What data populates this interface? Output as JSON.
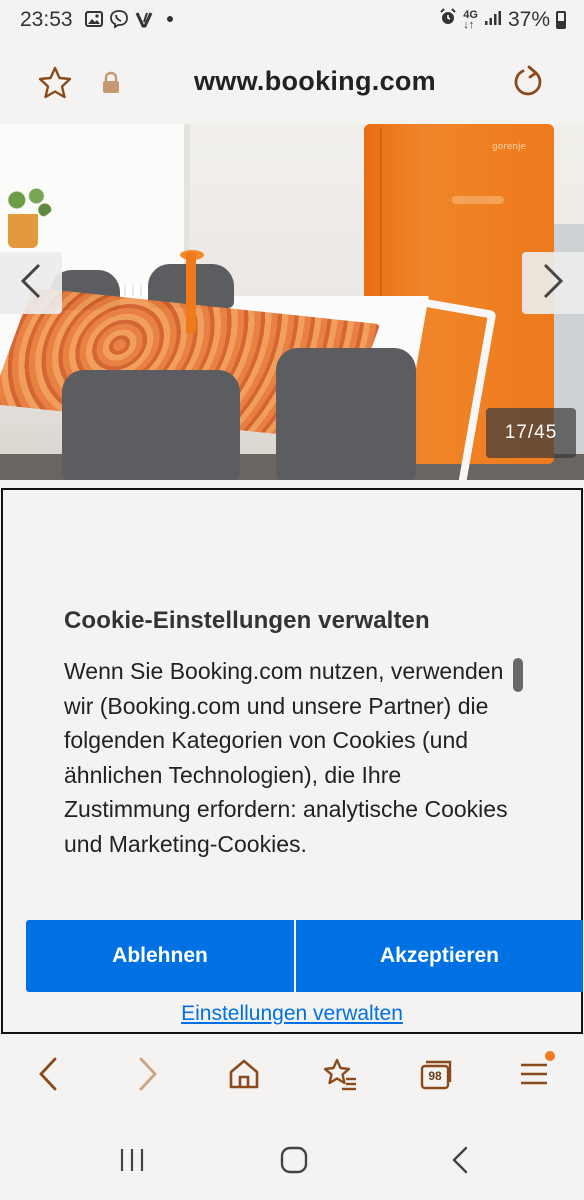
{
  "status_bar": {
    "time": "23:53",
    "battery": "37%",
    "network": "4G",
    "icons_left": [
      "image-icon",
      "viber-icon",
      "v-icon",
      "dot"
    ],
    "icons_right": [
      "alarm-icon",
      "network-4g-icon",
      "signal-icon",
      "battery-icon"
    ]
  },
  "browser": {
    "url": "www.booking.com"
  },
  "gallery": {
    "counter": "17/45",
    "current": 17,
    "total": 45
  },
  "cookie_dialog": {
    "title": "Cookie-Einstellungen verwalten",
    "body": "Wenn Sie Booking.com nutzen, verwenden wir (Booking.com und unsere Partner) die folgenden Kategorien von Cookies (und ähnlichen Technologien), die Ihre Zustimmung erfordern: analytische Cookies und Marketing-Cookies.",
    "decline_label": "Ablehnen",
    "accept_label": "Akzeptieren",
    "manage_label": "Einstellungen verwalten"
  },
  "bottom_bar": {
    "tab_count": "98"
  },
  "colors": {
    "accent": "#0071e2",
    "icon_brown": "#8a4a1c",
    "menu_badge": "#f07a22",
    "background": "#f4f3f2"
  }
}
